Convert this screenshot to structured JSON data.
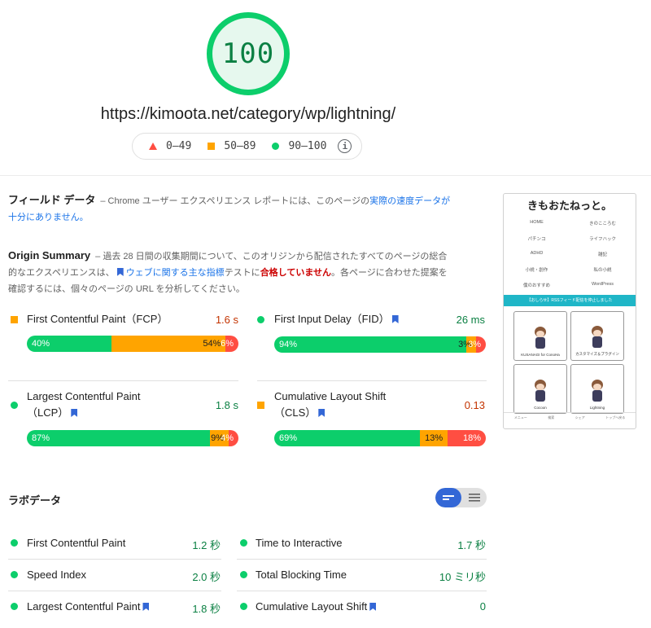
{
  "score": "100",
  "url": "https://kimoota.net/category/wp/lightning/",
  "legend": {
    "fail": "0–49",
    "average": "50–89",
    "pass": "90–100",
    "info_icon": "info-icon"
  },
  "field": {
    "title": "フィールド データ",
    "desc_prefix": "– Chrome ユーザー エクスペリエンス レポートには、このページの",
    "desc_link": "実際の速度データが十分にありません。",
    "origin_title": "Origin Summary",
    "origin_desc_1": "– 過去 28 日間の収集期間について、このオリジンから配信されたすべてのページの総合的なエクスペリエンスは、",
    "origin_link": "ウェブに関する主な指標",
    "origin_desc_2": "テストに",
    "origin_fail": "合格していません",
    "origin_desc_3": "。各ページに合わせた提案を確認するには、個々のページの URL を分析してください。",
    "metrics": [
      {
        "label": "First Contentful Paint（FCP）",
        "value": "1.6 s",
        "status": "average",
        "bookmark": false,
        "dist": [
          "40%",
          "54%",
          "6%"
        ],
        "shares": [
          40,
          54,
          6
        ]
      },
      {
        "label": "First Input Delay（FID）",
        "value": "26 ms",
        "status": "pass",
        "bookmark": true,
        "dist": [
          "94%",
          "3%",
          "3%"
        ],
        "shares": [
          94,
          3,
          3
        ]
      },
      {
        "label": "Largest Contentful Paint",
        "label2": "（LCP）",
        "value": "1.8 s",
        "status": "pass",
        "bookmark": true,
        "dist": [
          "87%",
          "9%",
          "4%"
        ],
        "shares": [
          87,
          9,
          4
        ]
      },
      {
        "label": "Cumulative Layout Shift",
        "label2": "（CLS）",
        "value": "0.13",
        "status": "average",
        "bookmark": true,
        "dist": [
          "69%",
          "13%",
          "18%"
        ],
        "shares": [
          69,
          13,
          18
        ]
      }
    ]
  },
  "lab": {
    "title": "ラボデータ",
    "left": [
      {
        "label": "First Contentful Paint",
        "value": "1.2 秒",
        "bookmark": false
      },
      {
        "label": "Speed Index",
        "value": "2.0 秒",
        "bookmark": false
      },
      {
        "label": "Largest Contentful Paint",
        "value": "1.8 秒",
        "bookmark": true
      }
    ],
    "right": [
      {
        "label": "Time to Interactive",
        "value": "1.7 秒",
        "bookmark": false
      },
      {
        "label": "Total Blocking Time",
        "value": "10 ミリ秒",
        "bookmark": false
      },
      {
        "label": "Cumulative Layout Shift",
        "value": "0",
        "bookmark": true
      }
    ]
  },
  "thumb": {
    "title": "きもおたねっと。",
    "nav": [
      "HOME",
      "きのこころむ",
      "パチンコ",
      "ライフハック",
      "ADHD",
      "雑記",
      "小説・創作",
      "私の小説",
      "僕のおすすめ",
      "WordPress"
    ],
    "banner": "【おしらせ】RSSフィード配信を停止しました",
    "cards": [
      "KUSANAGI for ConoHa",
      "カスタマイズ＆プラグイン",
      "Cocoon",
      "Lightning"
    ],
    "footer": [
      "メニュー",
      "検索",
      "シェア",
      "トップへ戻る"
    ]
  },
  "colors": {
    "pass": "#0cce6b",
    "pass_text": "#0b8043",
    "average": "#ffa400",
    "average_text": "#c33300",
    "fail": "#ff4e42",
    "accent": "#3367d6"
  }
}
